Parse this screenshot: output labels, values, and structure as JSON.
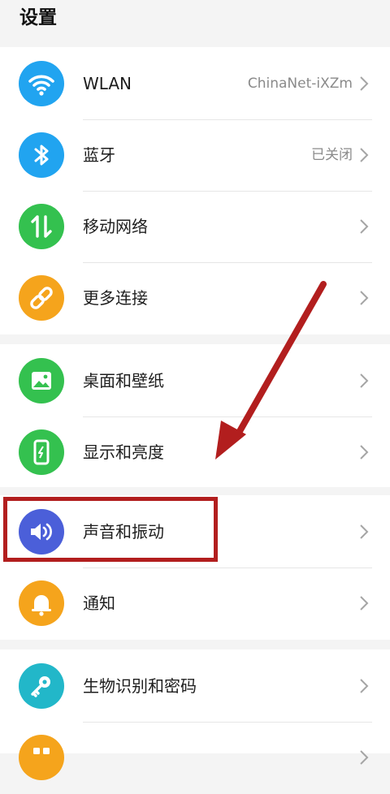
{
  "header": {
    "title": "设置"
  },
  "items": [
    {
      "id": "wlan",
      "label": "WLAN",
      "value": "ChinaNet-iXZm",
      "icon": "wifi-icon",
      "color": "#21a4f0"
    },
    {
      "id": "bluetooth",
      "label": "蓝牙",
      "value": "已关闭",
      "icon": "bluetooth-icon",
      "color": "#21a4f0"
    },
    {
      "id": "mobile-network",
      "label": "移动网络",
      "value": "",
      "icon": "mobile-data-icon",
      "color": "#34c14f"
    },
    {
      "id": "more-connections",
      "label": "更多连接",
      "value": "",
      "icon": "link-icon",
      "color": "#f5a41c"
    },
    {
      "id": "desktop-wallpaper",
      "label": "桌面和壁纸",
      "value": "",
      "icon": "image-icon",
      "color": "#34c14f"
    },
    {
      "id": "display-brightness",
      "label": "显示和亮度",
      "value": "",
      "icon": "phone-icon",
      "color": "#34c14f"
    },
    {
      "id": "sound-vibration",
      "label": "声音和振动",
      "value": "",
      "icon": "speaker-icon",
      "color": "#4b5fd9"
    },
    {
      "id": "notifications",
      "label": "通知",
      "value": "",
      "icon": "bell-icon",
      "color": "#f5a41c"
    },
    {
      "id": "biometrics-password",
      "label": "生物识别和密码",
      "value": "",
      "icon": "key-icon",
      "color": "#22b7c9"
    }
  ],
  "annotation": {
    "color": "#b21e1e"
  }
}
